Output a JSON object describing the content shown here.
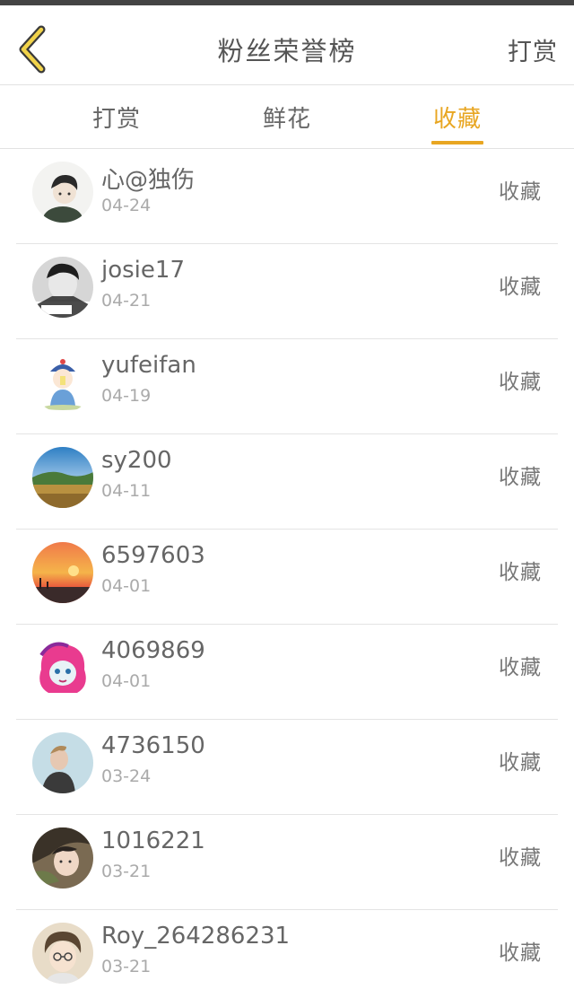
{
  "header": {
    "title": "粉丝荣誉榜",
    "action_label": "打赏"
  },
  "tabs": [
    {
      "label": "打赏",
      "active": false
    },
    {
      "label": "鲜花",
      "active": false
    },
    {
      "label": "收藏",
      "active": true
    }
  ],
  "accent_color": "#e8a622",
  "fans": [
    {
      "name": "心@独伤",
      "date": "04-24",
      "action": "收藏"
    },
    {
      "name": "josie17",
      "date": "04-21",
      "action": "收藏"
    },
    {
      "name": "yufeifan",
      "date": "04-19",
      "action": "收藏"
    },
    {
      "name": "sy200",
      "date": "04-11",
      "action": "收藏"
    },
    {
      "name": "6597603",
      "date": "04-01",
      "action": "收藏"
    },
    {
      "name": "4069869",
      "date": "04-01",
      "action": "收藏"
    },
    {
      "name": "4736150",
      "date": "03-24",
      "action": "收藏"
    },
    {
      "name": "1016221",
      "date": "03-21",
      "action": "收藏"
    },
    {
      "name": "Roy_264286231",
      "date": "03-21",
      "action": "收藏"
    }
  ]
}
